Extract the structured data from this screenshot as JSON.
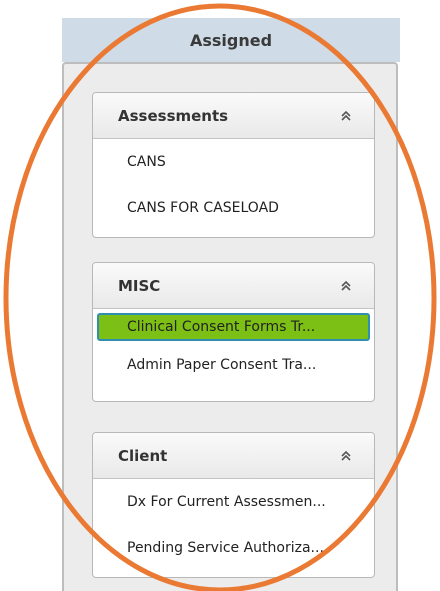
{
  "panel": {
    "title": "Assigned"
  },
  "sections": [
    {
      "title": "Assessments",
      "icon": "double-chevron-up-icon",
      "items": [
        {
          "label": "CANS",
          "selected": false
        },
        {
          "label": "CANS FOR CASELOAD",
          "selected": false
        }
      ]
    },
    {
      "title": "MISC",
      "icon": "double-chevron-up-icon",
      "items": [
        {
          "label": "Clinical Consent Forms Tr...",
          "selected": true
        },
        {
          "label": "Admin Paper Consent Tra...",
          "selected": false
        }
      ]
    },
    {
      "title": "Client",
      "icon": "double-chevron-up-icon",
      "items": [
        {
          "label": "Dx For Current Assessmen...",
          "selected": false
        },
        {
          "label": "Pending Service Authoriza...",
          "selected": false
        }
      ]
    }
  ],
  "colors": {
    "header_bg": "#cfdce8",
    "selected_bg": "#7cbf15",
    "selected_border": "#2f8fb0",
    "annotation": "#ea7a33"
  }
}
